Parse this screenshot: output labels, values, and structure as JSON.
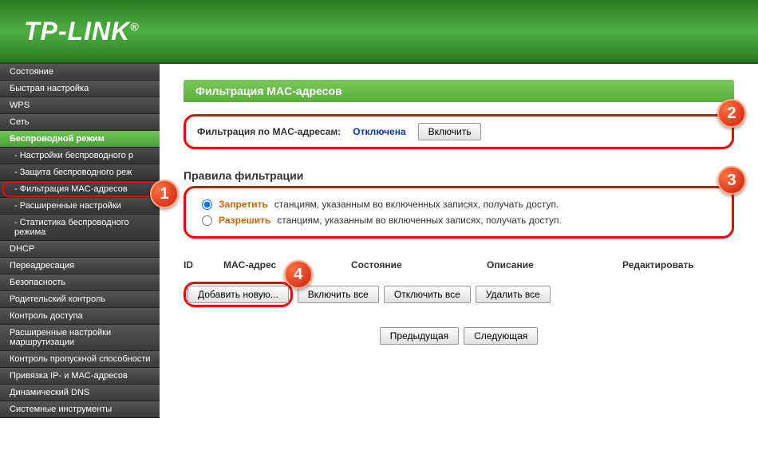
{
  "header": {
    "logo": "TP-LINK"
  },
  "sidebar": {
    "items": [
      {
        "label": "Состояние",
        "type": "main"
      },
      {
        "label": "Быстрая настройка",
        "type": "main"
      },
      {
        "label": "WPS",
        "type": "main"
      },
      {
        "label": "Сеть",
        "type": "main"
      },
      {
        "label": "Беспроводной режим",
        "type": "active"
      },
      {
        "label": "- Настройки беспроводного р",
        "type": "sub"
      },
      {
        "label": "- Защита беспроводного реж",
        "type": "sub"
      },
      {
        "label": "- Фильтрация MAC-адресов",
        "type": "selected-sub"
      },
      {
        "label": "- Расширенные настройки",
        "type": "sub"
      },
      {
        "label": "- Статистика беспроводного режима",
        "type": "sub"
      },
      {
        "label": "DHCP",
        "type": "main"
      },
      {
        "label": "Переадресация",
        "type": "main"
      },
      {
        "label": "Безопасность",
        "type": "main"
      },
      {
        "label": "Родительский контроль",
        "type": "main"
      },
      {
        "label": "Контроль доступа",
        "type": "main"
      },
      {
        "label": "Расширенные настройки маршрутизации",
        "type": "main"
      },
      {
        "label": "Контроль пропускной способности",
        "type": "main"
      },
      {
        "label": "Привязка IP- и MAC-адресов",
        "type": "main"
      },
      {
        "label": "Динамический DNS",
        "type": "main"
      },
      {
        "label": "Системные инструменты",
        "type": "main"
      }
    ]
  },
  "content": {
    "title": "Фильтрация MAC-адресов",
    "filter_label": "Фильтрация по MAC-адресам:",
    "filter_status": "Отключена",
    "enable_btn": "Включить",
    "rules_title": "Правила фильтрации",
    "rule_deny_strong": "Запретить",
    "rule_deny_text": " станциям, указанным во включенных записях, получать доступ.",
    "rule_allow_strong": "Разрешить",
    "rule_allow_text": " станциям, указанным во включенных записях, получать доступ.",
    "th_id": "ID",
    "th_mac": "MAC-адрес",
    "th_state": "Состояние",
    "th_desc": "Описание",
    "th_edit": "Редактировать",
    "btn_add": "Добавить новую...",
    "btn_enable_all": "Включить все",
    "btn_disable_all": "Отключить все",
    "btn_delete_all": "Удалить все",
    "btn_prev": "Предыдущая",
    "btn_next": "Следующая"
  },
  "badges": {
    "one": "1",
    "two": "2",
    "three": "3",
    "four": "4"
  }
}
